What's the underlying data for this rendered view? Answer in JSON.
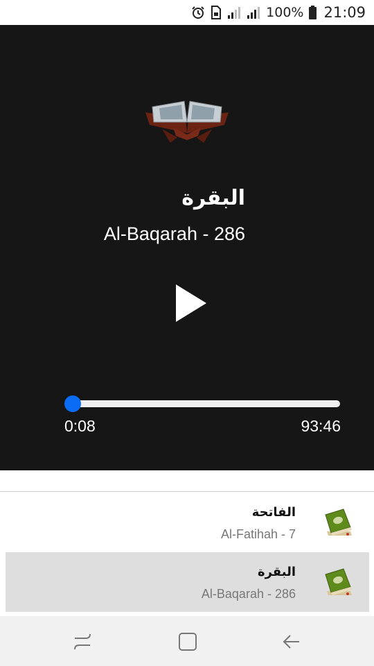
{
  "status_bar": {
    "icons": [
      "alarm-icon",
      "sim-card-icon",
      "signal-icon",
      "signal-icon",
      "battery-icon"
    ],
    "battery_percent": "100%",
    "time": "21:09"
  },
  "player": {
    "now_playing": {
      "arabic_name": "البقرة",
      "latin_name": "Al-Baqarah - 286"
    },
    "play_icon": "play-icon",
    "progress_fraction": 0.0014,
    "elapsed": "0:08",
    "duration": "93:46",
    "accent_color": "#0a6cf5"
  },
  "playlist": {
    "items": [
      {
        "arabic_name": "الفاتحة",
        "latin_name": "Al-Fatihah - 7",
        "icon": "quran-book-icon",
        "active": false
      },
      {
        "arabic_name": "البقرة",
        "latin_name": "Al-Baqarah - 286",
        "icon": "quran-book-icon",
        "active": true
      }
    ]
  },
  "nav_bar": {
    "buttons": [
      "recent-apps-icon",
      "home-icon",
      "back-icon"
    ]
  }
}
